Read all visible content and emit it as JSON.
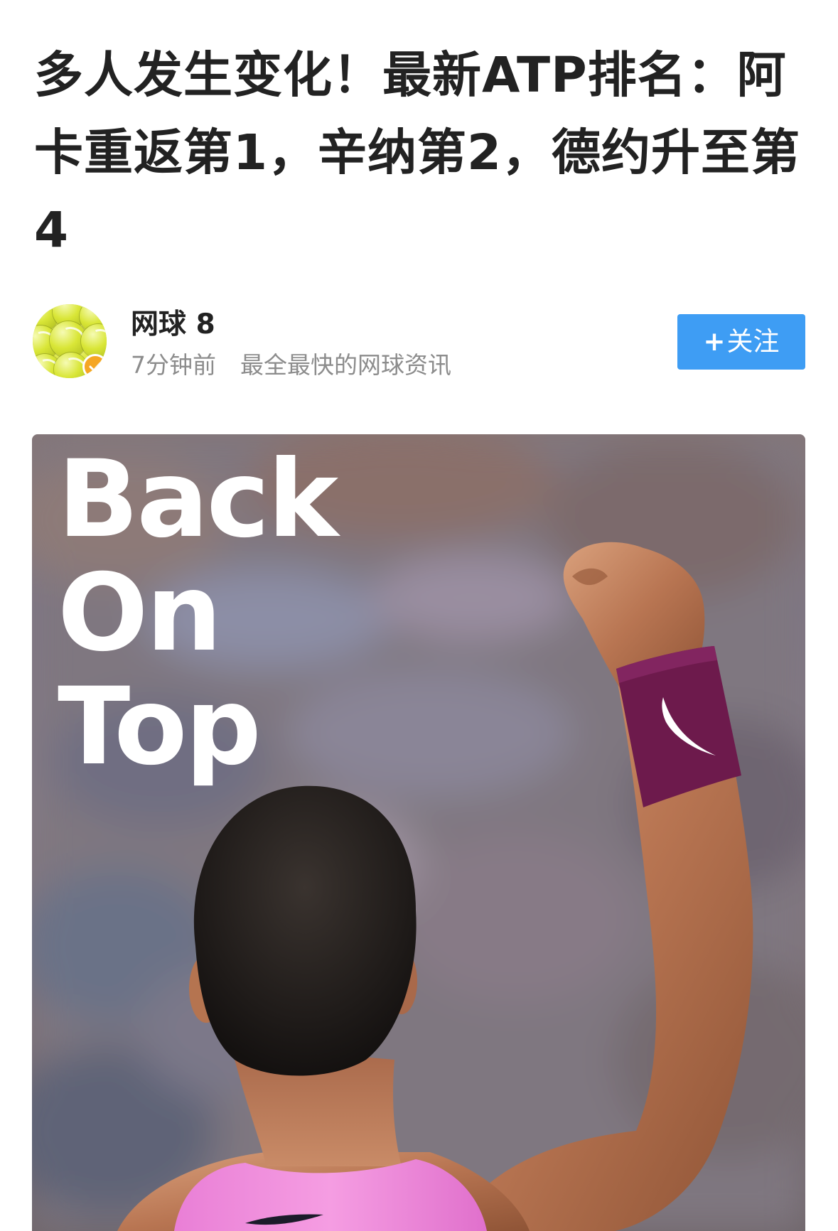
{
  "article": {
    "title": "多人发生变化！最新ATP排名：阿卡重返第1，辛纳第2，德约升至第4"
  },
  "author": {
    "name": "网球 8",
    "time": "7分钟前",
    "description": "最全最快的网球资讯",
    "avatar_icon": "tennis-balls-avatar",
    "verified_icon": "verified-badge-icon",
    "verified_color": "#f5a623"
  },
  "follow": {
    "plus": "+",
    "label": "关注",
    "color": "#3e9df4"
  },
  "hero": {
    "line1": "Back",
    "line2": "On",
    "line3": "Top"
  }
}
